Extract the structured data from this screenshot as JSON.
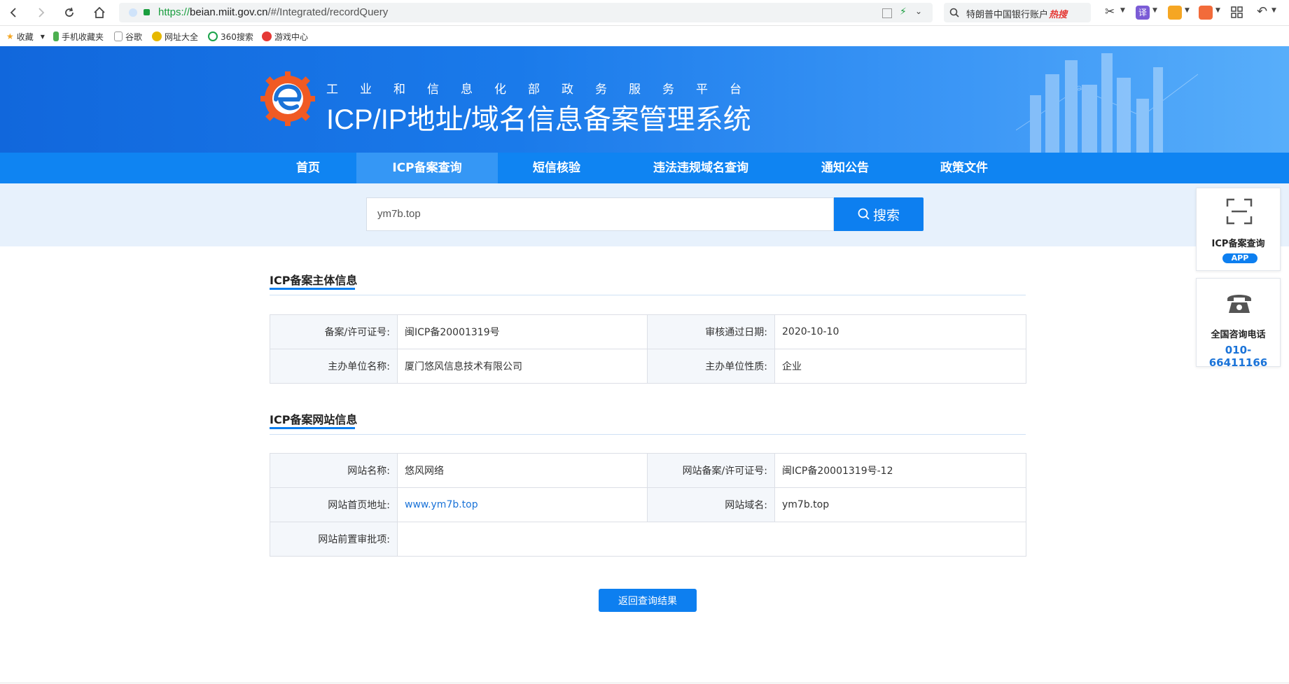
{
  "browser": {
    "url_protocol": "https://",
    "url_host": "beian.miit.gov.cn",
    "url_path": "/#/Integrated/recordQuery",
    "hot_search_text": "特朗普中国银行账户",
    "hot_search_badge": "热搜"
  },
  "bookmarks": [
    {
      "label": "收藏",
      "icon": "star-icon"
    },
    {
      "label": "手机收藏夹",
      "icon": "phone-icon"
    },
    {
      "label": "谷歌",
      "icon": "page-icon"
    },
    {
      "label": "网址大全",
      "icon": "globe-icon"
    },
    {
      "label": "360搜索",
      "icon": "search-360-icon"
    },
    {
      "label": "游戏中心",
      "icon": "game-icon"
    }
  ],
  "header": {
    "subtitle": "工业和信息化部政务服务平台",
    "title": "ICP/IP地址/域名信息备案管理系统"
  },
  "nav": {
    "items": [
      "首页",
      "ICP备案查询",
      "短信核验",
      "违法违规域名查询",
      "通知公告",
      "政策文件"
    ],
    "active": "ICP备案查询"
  },
  "search": {
    "value": "ym7b.top",
    "button_label": "搜索"
  },
  "subject_section": {
    "title": "ICP备案主体信息",
    "rows": [
      [
        {
          "label": "备案/许可证号:",
          "value": "闽ICP备20001319号"
        },
        {
          "label": "审核通过日期:",
          "value": "2020-10-10"
        }
      ],
      [
        {
          "label": "主办单位名称:",
          "value": "厦门悠风信息技术有限公司"
        },
        {
          "label": "主办单位性质:",
          "value": "企业"
        }
      ]
    ]
  },
  "website_section": {
    "title": "ICP备案网站信息",
    "rows": [
      [
        {
          "label": "网站名称:",
          "value": "悠风网络"
        },
        {
          "label": "网站备案/许可证号:",
          "value": "闽ICP备20001319号-12"
        }
      ],
      [
        {
          "label": "网站首页地址:",
          "value": "www.ym7b.top"
        },
        {
          "label": "网站域名:",
          "value": "ym7b.top"
        }
      ],
      [
        {
          "label": "网站前置审批项:",
          "value": ""
        }
      ]
    ]
  },
  "back_button": "返回查询结果",
  "side": {
    "app_label": "ICP备案查询",
    "app_badge": "APP",
    "phone_label": "全国咨询电话",
    "phone_number": "010-66411166"
  }
}
